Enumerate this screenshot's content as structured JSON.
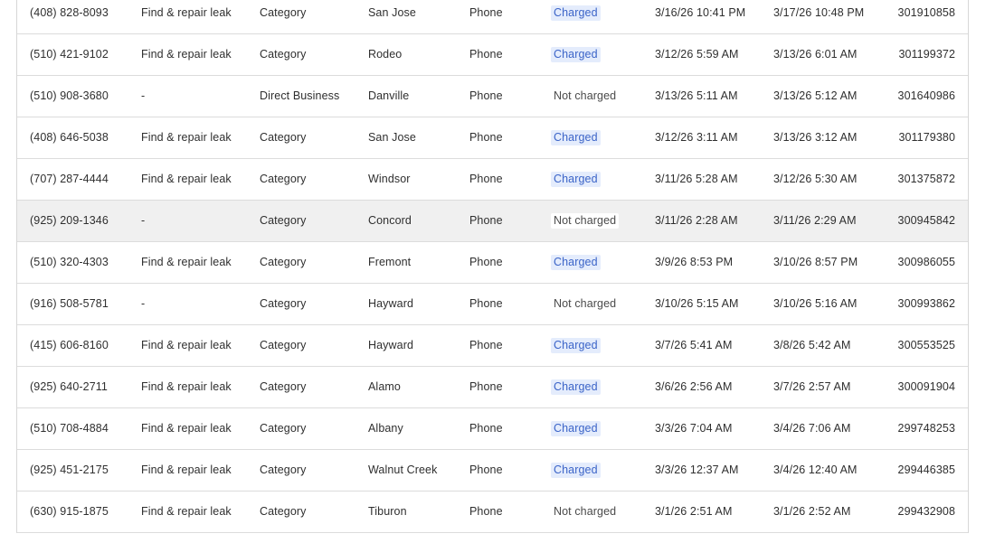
{
  "table": {
    "rows": [
      {
        "phone": "(408) 828-8093",
        "reason": "Find & repair leak",
        "type": "Category",
        "city": "San Jose",
        "source": "Phone",
        "status": "Charged",
        "charged": true,
        "start": "3/16/26 10:41 PM",
        "end": "3/17/26 10:48 PM",
        "id": "301910858"
      },
      {
        "phone": "(510) 421-9102",
        "reason": "Find & repair leak",
        "type": "Category",
        "city": "Rodeo",
        "source": "Phone",
        "status": "Charged",
        "charged": true,
        "start": "3/12/26 5:59 AM",
        "end": "3/13/26 6:01 AM",
        "id": "301199372"
      },
      {
        "phone": "(510) 908-3680",
        "reason": "-",
        "type": "Direct Business",
        "city": "Danville",
        "source": "Phone",
        "status": "Not charged",
        "charged": false,
        "start": "3/13/26 5:11 AM",
        "end": "3/13/26 5:12 AM",
        "id": "301640986"
      },
      {
        "phone": "(408) 646-5038",
        "reason": "Find & repair leak",
        "type": "Category",
        "city": "San Jose",
        "source": "Phone",
        "status": "Charged",
        "charged": true,
        "start": "3/12/26 3:11 AM",
        "end": "3/13/26 3:12 AM",
        "id": "301179380"
      },
      {
        "phone": "(707) 287-4444",
        "reason": "Find & repair leak",
        "type": "Category",
        "city": "Windsor",
        "source": "Phone",
        "status": "Charged",
        "charged": true,
        "start": "3/11/26 5:28 AM",
        "end": "3/12/26 5:30 AM",
        "id": "301375872"
      },
      {
        "phone": "(925) 209-1346",
        "reason": "-",
        "type": "Category",
        "city": "Concord",
        "source": "Phone",
        "status": "Not charged",
        "charged": false,
        "start": "3/11/26 2:28 AM",
        "end": "3/11/26 2:29 AM",
        "id": "300945842",
        "hovered": true
      },
      {
        "phone": "(510) 320-4303",
        "reason": "Find & repair leak",
        "type": "Category",
        "city": "Fremont",
        "source": "Phone",
        "status": "Charged",
        "charged": true,
        "start": "3/9/26 8:53 PM",
        "end": "3/10/26 8:57 PM",
        "id": "300986055"
      },
      {
        "phone": "(916) 508-5781",
        "reason": "-",
        "type": "Category",
        "city": "Hayward",
        "source": "Phone",
        "status": "Not charged",
        "charged": false,
        "start": "3/10/26 5:15 AM",
        "end": "3/10/26 5:16 AM",
        "id": "300993862"
      },
      {
        "phone": "(415) 606-8160",
        "reason": "Find & repair leak",
        "type": "Category",
        "city": "Hayward",
        "source": "Phone",
        "status": "Charged",
        "charged": true,
        "start": "3/7/26 5:41 AM",
        "end": "3/8/26 5:42 AM",
        "id": "300553525"
      },
      {
        "phone": "(925) 640-2711",
        "reason": "Find & repair leak",
        "type": "Category",
        "city": "Alamo",
        "source": "Phone",
        "status": "Charged",
        "charged": true,
        "start": "3/6/26 2:56 AM",
        "end": "3/7/26 2:57 AM",
        "id": "300091904"
      },
      {
        "phone": "(510) 708-4884",
        "reason": "Find & repair leak",
        "type": "Category",
        "city": "Albany",
        "source": "Phone",
        "status": "Charged",
        "charged": true,
        "start": "3/3/26 7:04 AM",
        "end": "3/4/26 7:06 AM",
        "id": "299748253"
      },
      {
        "phone": "(925) 451-2175",
        "reason": "Find & repair leak",
        "type": "Category",
        "city": "Walnut Creek",
        "source": "Phone",
        "status": "Charged",
        "charged": true,
        "start": "3/3/26 12:37 AM",
        "end": "3/4/26 12:40 AM",
        "id": "299446385"
      },
      {
        "phone": "(630) 915-1875",
        "reason": "Find & repair leak",
        "type": "Category",
        "city": "Tiburon",
        "source": "Phone",
        "status": "Not charged",
        "charged": false,
        "start": "3/1/26 2:51 AM",
        "end": "3/1/26 2:52 AM",
        "id": "299432908"
      }
    ]
  },
  "colors": {
    "charged_badge_bg": "#e4ecfc",
    "charged_badge_text": "#3b64c8",
    "row_hover_bg": "#f0f0f0",
    "row_border": "#dcdcdc"
  }
}
